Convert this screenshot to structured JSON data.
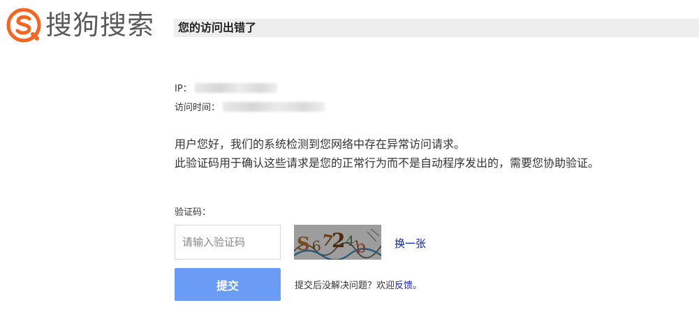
{
  "brand": {
    "name": "搜狗搜索",
    "accent_color": "#f26522",
    "logo_icon": "sogou-logo-icon"
  },
  "header": {
    "title": "您的访问出错了"
  },
  "info": {
    "ip_label": "IP：",
    "time_label": "访问时间："
  },
  "message": {
    "line1": "用户您好，我们的系统检测到您网络中存在异常访问请求。",
    "line2": "此验证码用于确认这些请求是您的正常行为而不是自动程序发出的，需要您协助验证。"
  },
  "captcha": {
    "label": "验证码：",
    "placeholder": "请输入验证码",
    "value": "",
    "image_text": "S6724b",
    "refresh_label": "换一张"
  },
  "form": {
    "submit_label": "提交",
    "help_prefix": "提交后没解决问题？欢迎",
    "feedback_label": "反馈",
    "help_suffix": "。",
    "button_color": "#6a9cf5",
    "link_color": "#0a1fa8"
  }
}
